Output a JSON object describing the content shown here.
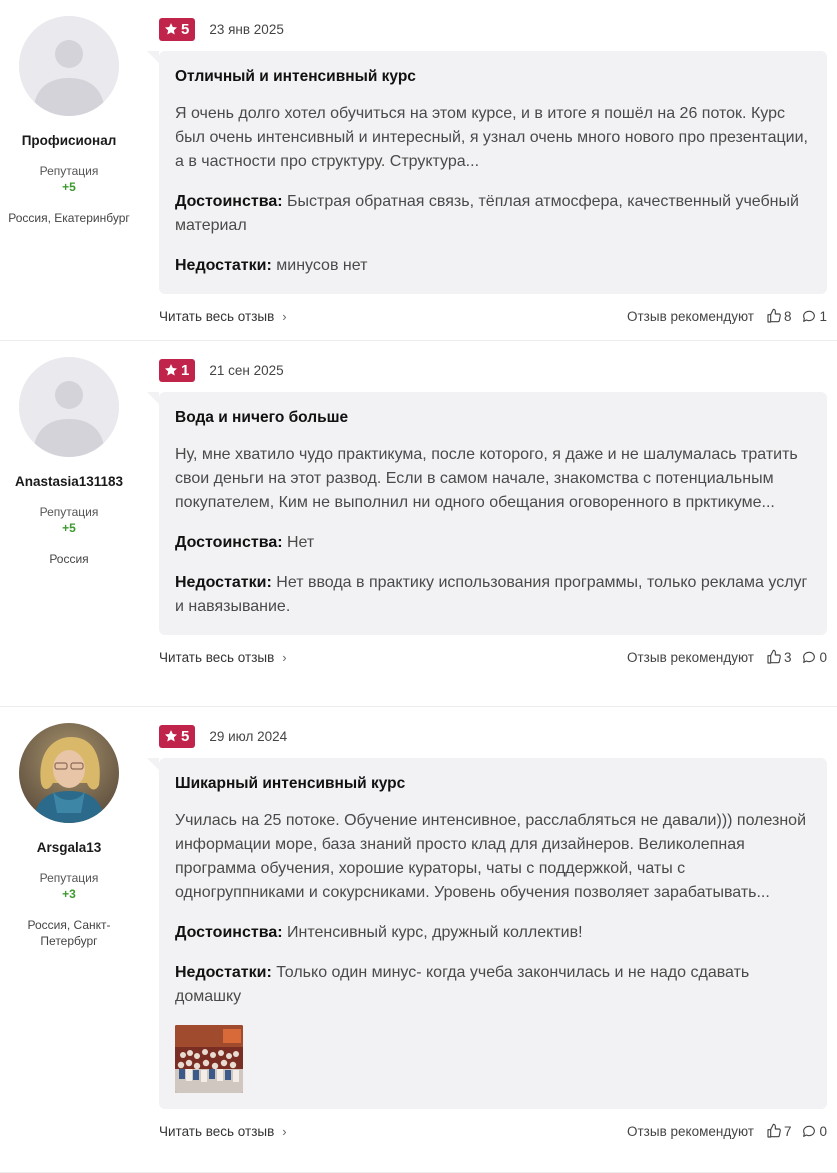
{
  "reviews": [
    {
      "author": "Профисионал",
      "reputation_label": "Репутация",
      "reputation": "+5",
      "location": "Россия, Екатеринбург",
      "rating": "5",
      "date": "23 янв 2025",
      "title": "Отличный и интенсивный курс",
      "text": "Я очень долго хотел обучиться на этом курсе, и в итоге я пошёл на 26 поток. Курс был очень интенсивный и интересный, я узнал очень много нового про презентации, а в частности про структуру. Структура...",
      "pros_label": "Достоинства:",
      "pros": "Быстрая обратная связь, тёплая атмосфера, качественный учебный материал",
      "cons_label": "Недостатки:",
      "cons": "минусов нет",
      "read_more": "Читать весь отзыв",
      "recommend_label": "Отзыв рекомендуют",
      "likes": "8",
      "comments": "1"
    },
    {
      "author": "Anastasia131183",
      "reputation_label": "Репутация",
      "reputation": "+5",
      "location": "Россия",
      "rating": "1",
      "date": "21 сен 2025",
      "title": "Вода и ничего больше",
      "text": "Ну, мне хватило чудо практикума, после которого, я даже и не шалумалась тратить свои деньги на этот развод. Если в самом начале, знакомства с потенциальным покупателем, Ким не выполнил ни одного обещания оговоренного в прктикуме...",
      "pros_label": "Достоинства:",
      "pros": "Нет",
      "cons_label": "Недостатки:",
      "cons": "Нет ввода в практику использования программы, только реклама услуг и навязывание.",
      "read_more": "Читать весь отзыв",
      "recommend_label": "Отзыв рекомендуют",
      "likes": "3",
      "comments": "0"
    },
    {
      "author": "Arsgala13",
      "reputation_label": "Репутация",
      "reputation": "+3",
      "location": "Россия, Санкт-Петербург",
      "rating": "5",
      "date": "29 июл 2024",
      "title": "Шикарный интенсивный курс",
      "text": "Училась на 25 потоке. Обучение интенсивное, расслабляться не давали))) полезной информации море, база знаний просто клад для дизайнеров. Великолепная программа обучения, хорошие кураторы, чаты с поддержкой, чаты с одногруппниками и сокурсниками. Уровень обучения позволяет зарабатывать...",
      "pros_label": "Достоинства:",
      "pros": "Интенсивный курс, дружный коллектив!",
      "cons_label": "Недостатки:",
      "cons": "Только один минус- когда учеба закончилась и не надо сдавать домашку",
      "read_more": "Читать весь отзыв",
      "recommend_label": "Отзыв рекомендуют",
      "likes": "7",
      "comments": "0"
    }
  ],
  "icons": {
    "star": "star-icon",
    "like": "thumbs-up-icon",
    "comment": "comment-icon",
    "chevron": "chevron-right-icon",
    "avatar_placeholder": "user-placeholder-icon"
  },
  "colors": {
    "rating_badge": "#c0244b",
    "reputation": "#3d9a2e",
    "card_bg": "#f2f2f4"
  }
}
